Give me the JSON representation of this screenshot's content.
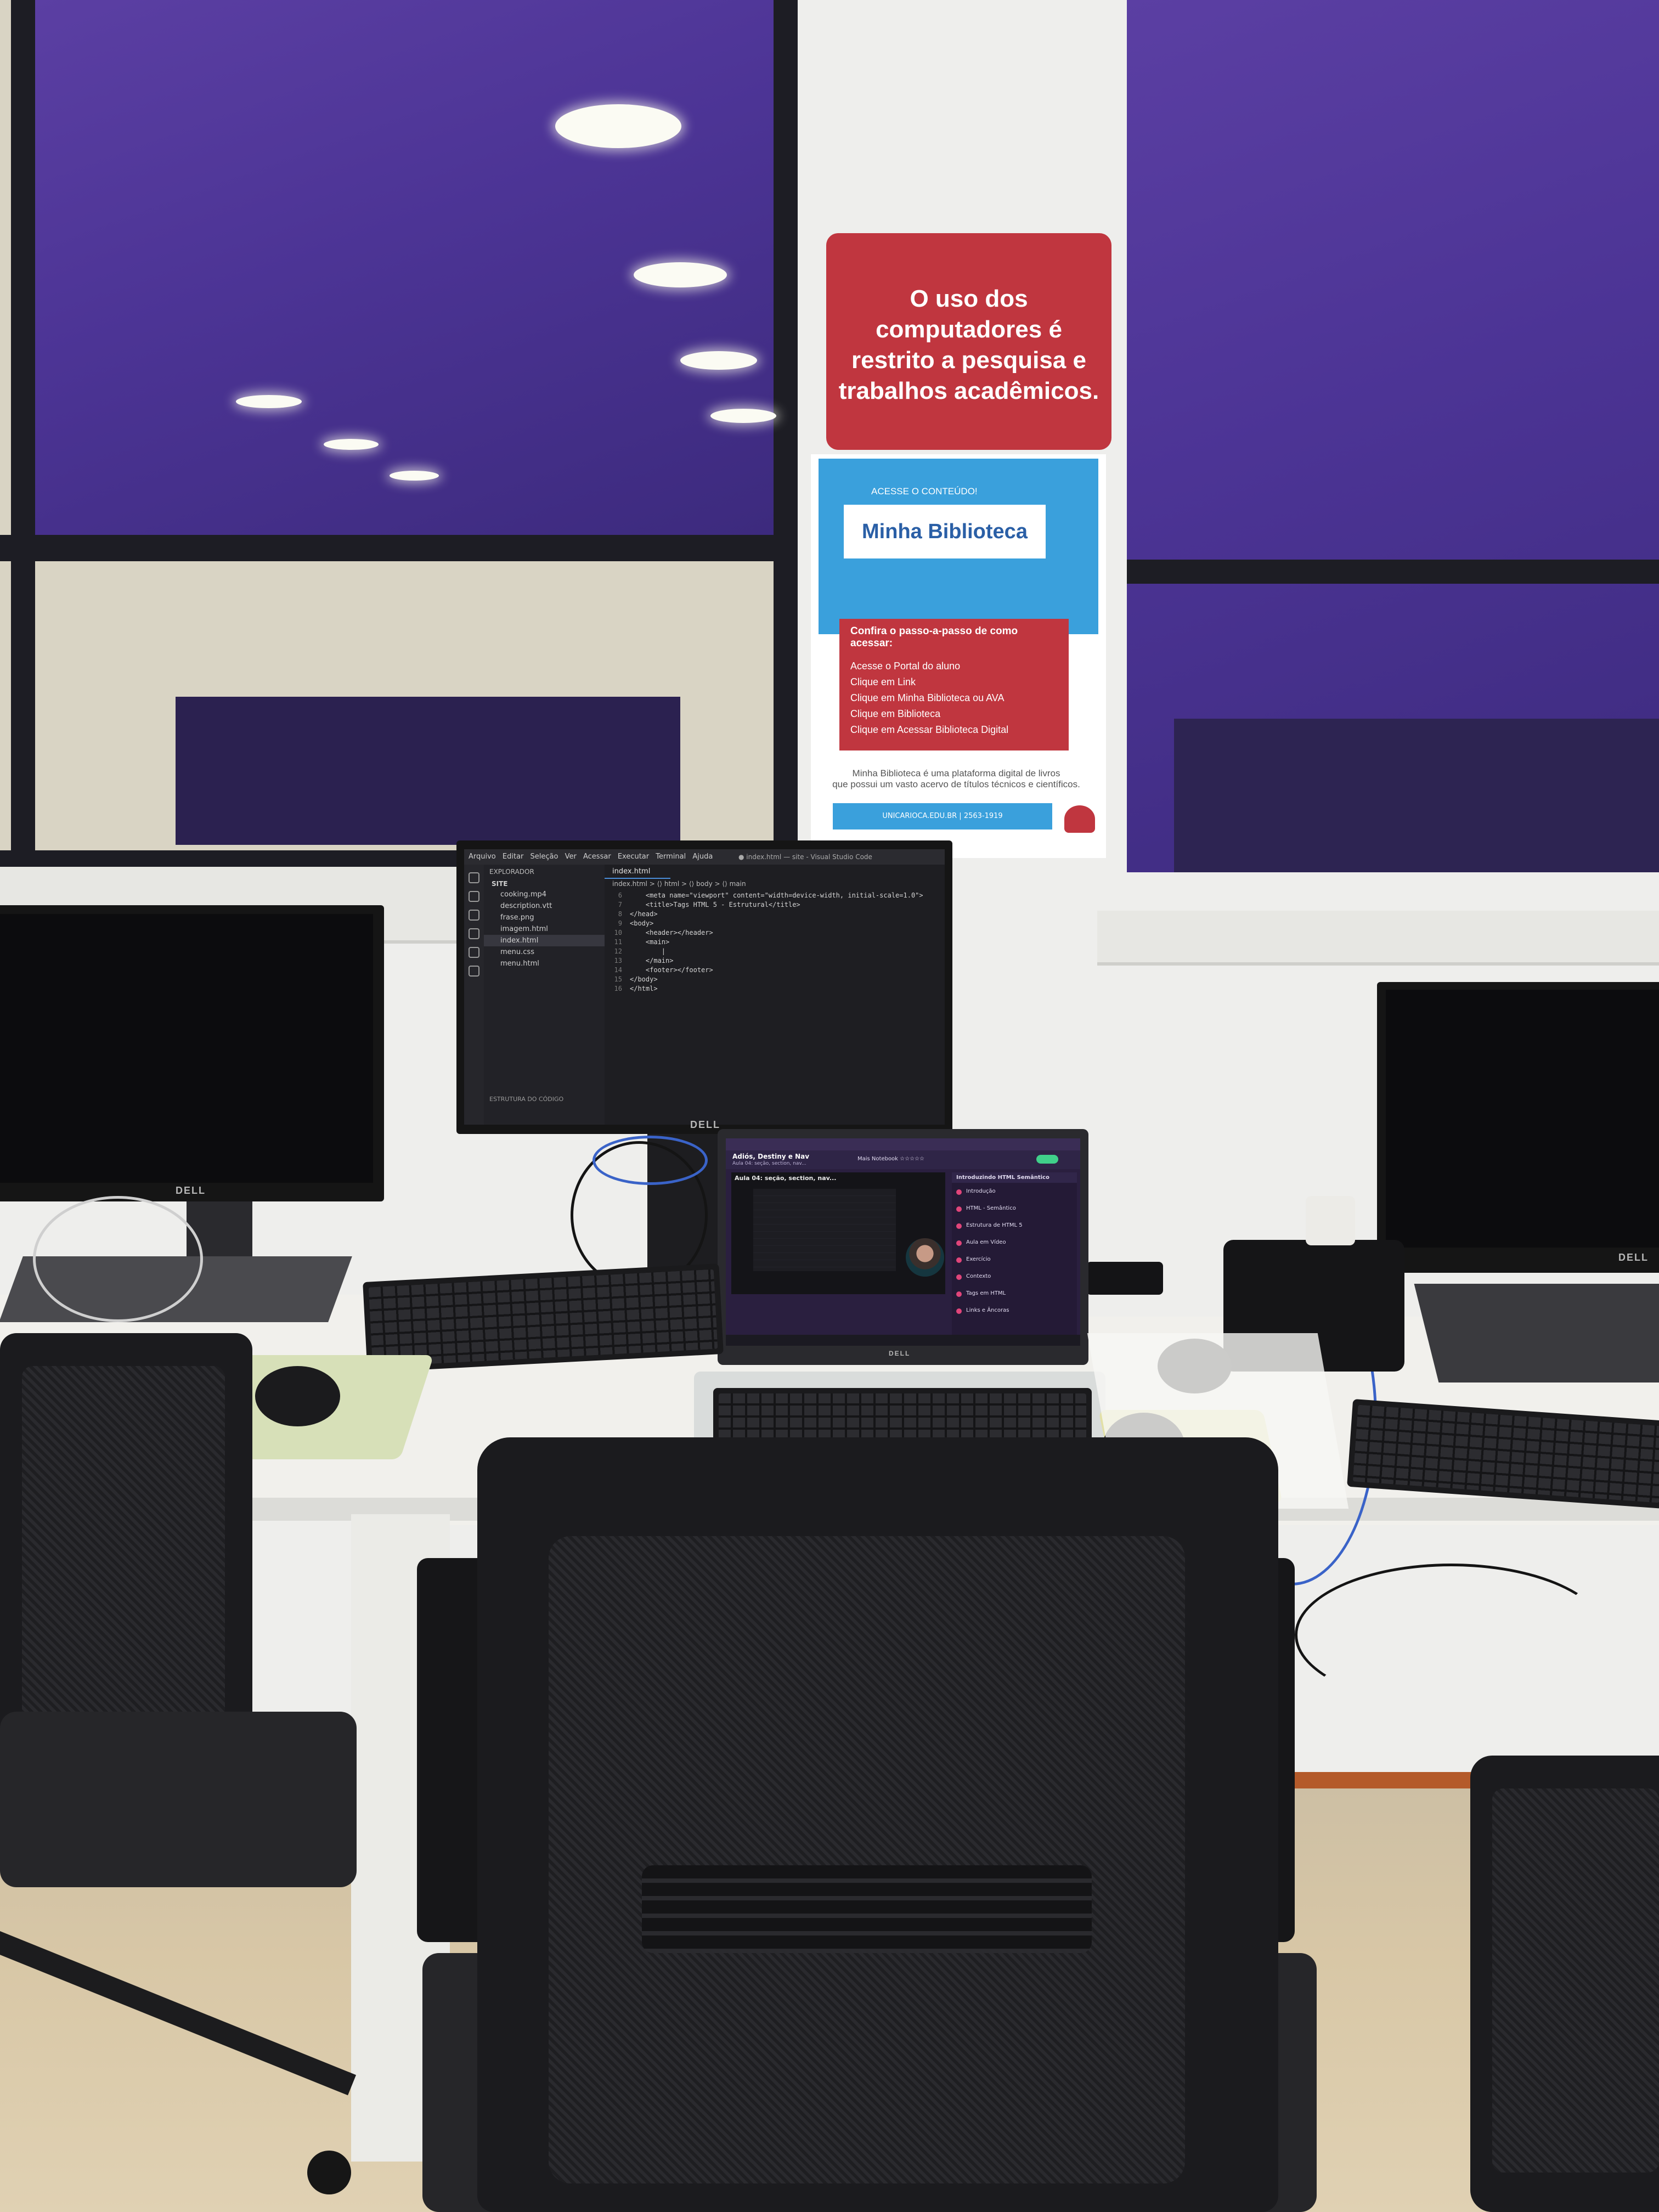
{
  "poster_red": {
    "text_lines": [
      "O uso dos",
      "computadores é",
      "restrito a pesquisa e",
      "trabalhos acadêmicos."
    ]
  },
  "poster_library": {
    "access_label": "ACESSE O CONTEÚDO!",
    "brand": "Minha Biblioteca",
    "steps_title": "Confira o passo-a-passo de como acessar:",
    "steps": [
      "Acesse o Portal do aluno",
      "Clique em Link",
      "Clique em  Minha Biblioteca ou AVA",
      "Clique em Biblioteca",
      "Clique em Acessar Biblioteca Digital"
    ],
    "description_lines": [
      "Minha Biblioteca é uma plataforma digital de livros",
      "que possui um vasto acervo de títulos técnicos e científicos."
    ],
    "footer": "UNICARIOCA.EDU.BR | 2563-1919"
  },
  "vscode": {
    "menu": [
      "Arquivo",
      "Editar",
      "Seleção",
      "Ver",
      "Acessar",
      "Executar",
      "Terminal",
      "Ajuda"
    ],
    "window_title": "● index.html — site - Visual Studio Code",
    "explorer_header": "EXPLORADOR",
    "folder": "SITE",
    "files": [
      "cooking.mp4",
      "description.vtt",
      "frase.png",
      "imagem.html",
      "index.html",
      "menu.css",
      "menu.html"
    ],
    "selected_file": "index.html",
    "outline_label": "ESTRUTURA DO CÓDIGO",
    "tab": "index.html",
    "breadcrumb": "index.html > ⟨⟩ html > ⟨⟩ body > ⟨⟩ main",
    "code_lines": [
      {
        "n": "6",
        "t": "    <meta name=\"viewport\" content=\"width=device-width, initial-scale=1.0\">"
      },
      {
        "n": "7",
        "t": "    <title>Tags HTML 5 - Estrutural</title>"
      },
      {
        "n": "8",
        "t": "</head>"
      },
      {
        "n": "9",
        "t": "<body>"
      },
      {
        "n": "10",
        "t": "    <header></header>"
      },
      {
        "n": "11",
        "t": "    <main>"
      },
      {
        "n": "12",
        "t": "        |"
      },
      {
        "n": "13",
        "t": "    </main>"
      },
      {
        "n": "14",
        "t": "    <footer></footer>"
      },
      {
        "n": "15",
        "t": "</body>"
      },
      {
        "n": "16",
        "t": "</html>"
      }
    ]
  },
  "laptop": {
    "course_title": "Adiós, Destiny e Nav",
    "course_subtitle": "Aula 04: seção, section, nav...",
    "video_title": "Aula 04: seção, section, nav...",
    "next_label": "Mais Notebook ☆☆☆☆☆",
    "sidebar_header": "Introduzindo HTML Semântico",
    "sidebar_items": [
      "Introdução",
      "HTML - Semântico",
      "Estrutura de HTML 5",
      "Aula em Vídeo",
      "Exercício",
      "Contexto",
      "Tags em HTML",
      "Links e Âncoras"
    ]
  },
  "monitor_brand": "DELL"
}
